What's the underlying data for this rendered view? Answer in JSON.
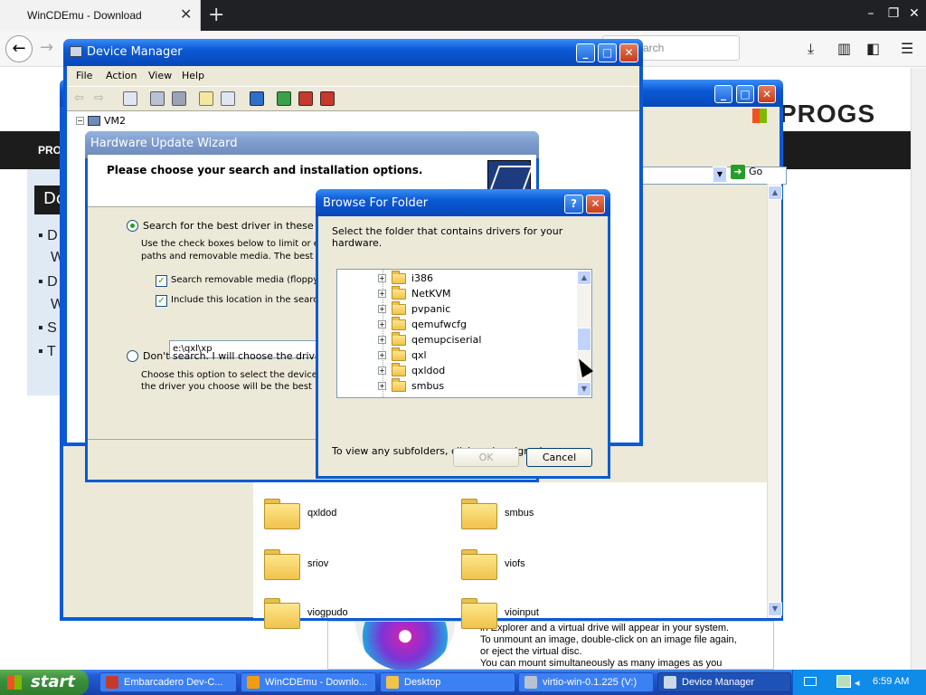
{
  "browser": {
    "tab_title": "WinCDEmu - Download",
    "search_placeholder": "arch",
    "page_band_label": "PRO",
    "page_left_title": "Do",
    "bullets": [
      "D",
      "W",
      "D",
      "W",
      "S",
      "T"
    ],
    "logo_text": "PROGS"
  },
  "explorer": {
    "go_label": "Go",
    "folders": [
      "qxldod",
      "smbus",
      "sriov",
      "viofs",
      "viogpudo",
      "vioinput"
    ],
    "info_text": [
      "in Explorer and a virtual drive will appear in your system.",
      "To unmount an image, double-click on an image file again,",
      "or eject the virtual disc.",
      "You can mount simultaneously as many images as you"
    ]
  },
  "device_manager": {
    "title": "Device Manager",
    "menu": [
      "File",
      "Action",
      "View",
      "Help"
    ],
    "tree_root": "VM2"
  },
  "wizard": {
    "title": "Hardware Update Wizard",
    "header": "Please choose your search and installation options.",
    "option1": "Search for the best driver in these location",
    "option1_desc_1": "Use the check boxes below to limit or exp",
    "option1_desc_2": "paths and removable media. The best driv",
    "check1": "Search removable media (floppy, C",
    "check2": "Include this location in the search:",
    "path": "e:\\qxl\\xp",
    "option2": "Don't search. I will choose the driver to in",
    "option2_desc_1": "Choose this option to select the device dri",
    "option2_desc_2": "the driver you choose will be the best mat"
  },
  "browse": {
    "title": "Browse For Folder",
    "help_btn": "?",
    "prompt": "Select the folder that contains drivers for your hardware.",
    "folders": [
      "i386",
      "NetKVM",
      "pvpanic",
      "qemufwcfg",
      "qemupciserial",
      "qxl",
      "qxldod",
      "smbus"
    ],
    "hint": "To view any subfolders, click a plus sign above.",
    "ok_label": "OK",
    "cancel_label": "Cancel"
  },
  "taskbar": {
    "start_label": "start",
    "tasks": [
      "Embarcadero Dev-C...",
      "WinCDEmu - Downlo...",
      "Desktop",
      "virtio-win-0.1.225 (V:)",
      "Device Manager"
    ],
    "clock": "6:59 AM"
  },
  "colors": {
    "xp_blue": "#0a5ad5",
    "xp_face": "#ece9d8",
    "start_green": "#3c8f3b"
  }
}
